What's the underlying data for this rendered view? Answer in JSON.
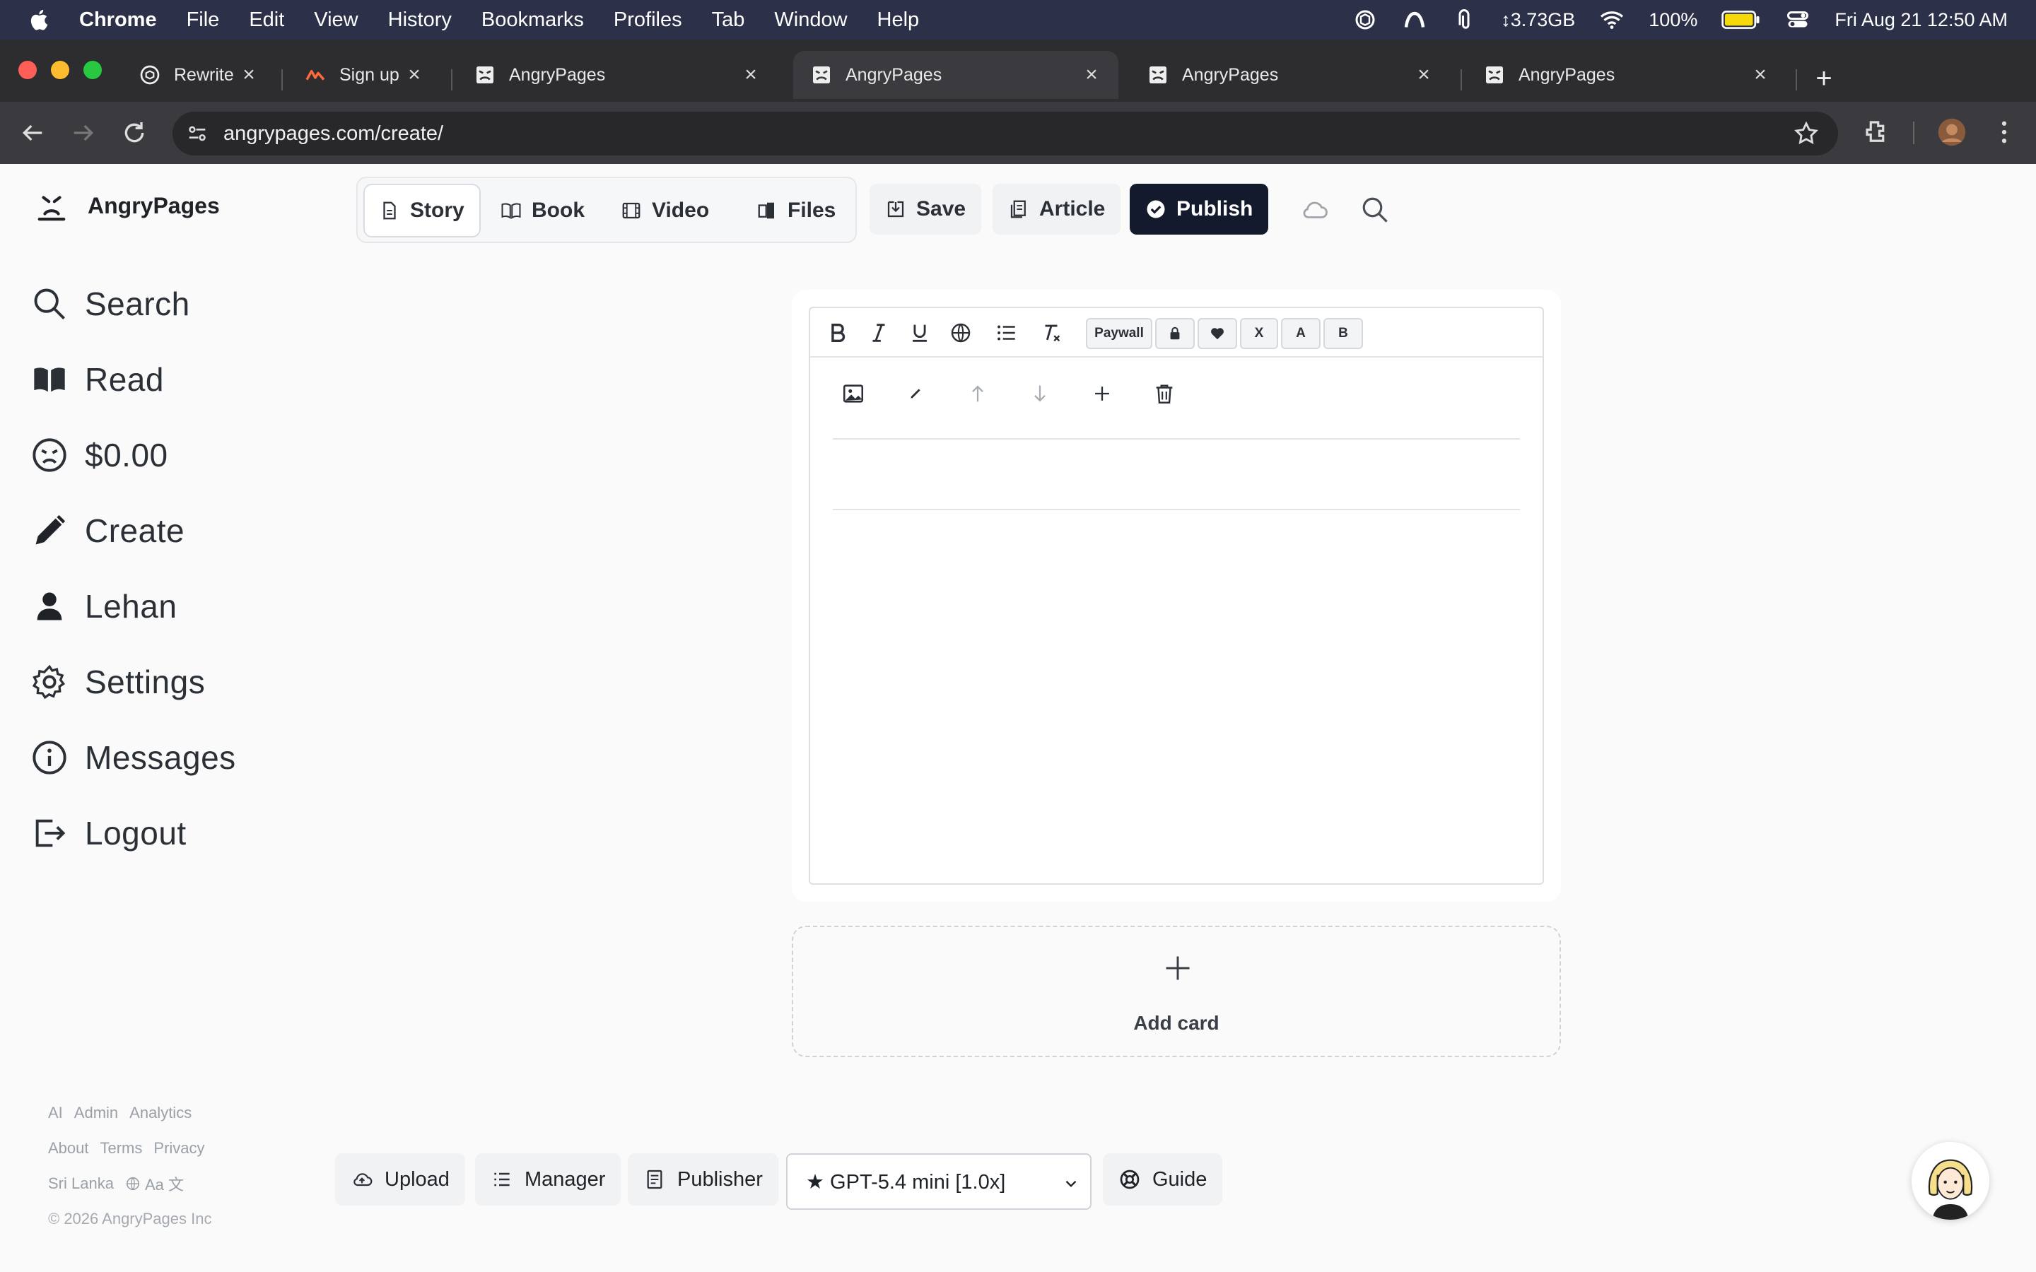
{
  "menubar": {
    "app": "Chrome",
    "items": [
      "File",
      "Edit",
      "View",
      "History",
      "Bookmarks",
      "Profiles",
      "Tab",
      "Window",
      "Help"
    ],
    "memory": "↕3.73GB",
    "battery": "100%",
    "datetime": "Fri Aug 21  12:50 AM"
  },
  "tabs": [
    {
      "title": "Rewrite h",
      "icon": "openai-icon"
    },
    {
      "title": "Sign up f",
      "icon": "brand-icon"
    },
    {
      "title": "AngryPages",
      "icon": "angrypages-icon"
    },
    {
      "title": "AngryPages",
      "icon": "angrypages-icon",
      "active": true
    },
    {
      "title": "AngryPages",
      "icon": "angrypages-icon"
    },
    {
      "title": "AngryPages",
      "icon": "angrypages-icon"
    }
  ],
  "browser": {
    "url": "angrypages.com/create/"
  },
  "brand": {
    "name": "AngryPages"
  },
  "nav": {
    "search": "Search",
    "read": "Read",
    "balance": "$0.00",
    "create": "Create",
    "user": "Lehan",
    "settings": "Settings",
    "messages": "Messages",
    "logout": "Logout"
  },
  "footer": {
    "row1": [
      "AI",
      "Admin",
      "Analytics"
    ],
    "row2": [
      "About",
      "Terms",
      "Privacy"
    ],
    "region": "Sri Lanka",
    "lang": "Aa 文",
    "copyright": "© 2026 AngryPages Inc"
  },
  "modes": {
    "story": "Story",
    "book": "Book",
    "video": "Video",
    "files": "Files"
  },
  "actions": {
    "save": "Save",
    "article": "Article",
    "publish": "Publish"
  },
  "editor": {
    "paywall": "Paywall",
    "x": "X",
    "a": "A",
    "b": "B"
  },
  "addcard": {
    "label": "Add card"
  },
  "bottom": {
    "upload": "Upload",
    "manager": "Manager",
    "publisher": "Publisher",
    "model": "★ GPT-5.4 mini [1.0x]",
    "guide": "Guide"
  },
  "colors": {
    "menubar": "#2c3048",
    "primary": "#141a2e",
    "page": "#fafafa"
  }
}
